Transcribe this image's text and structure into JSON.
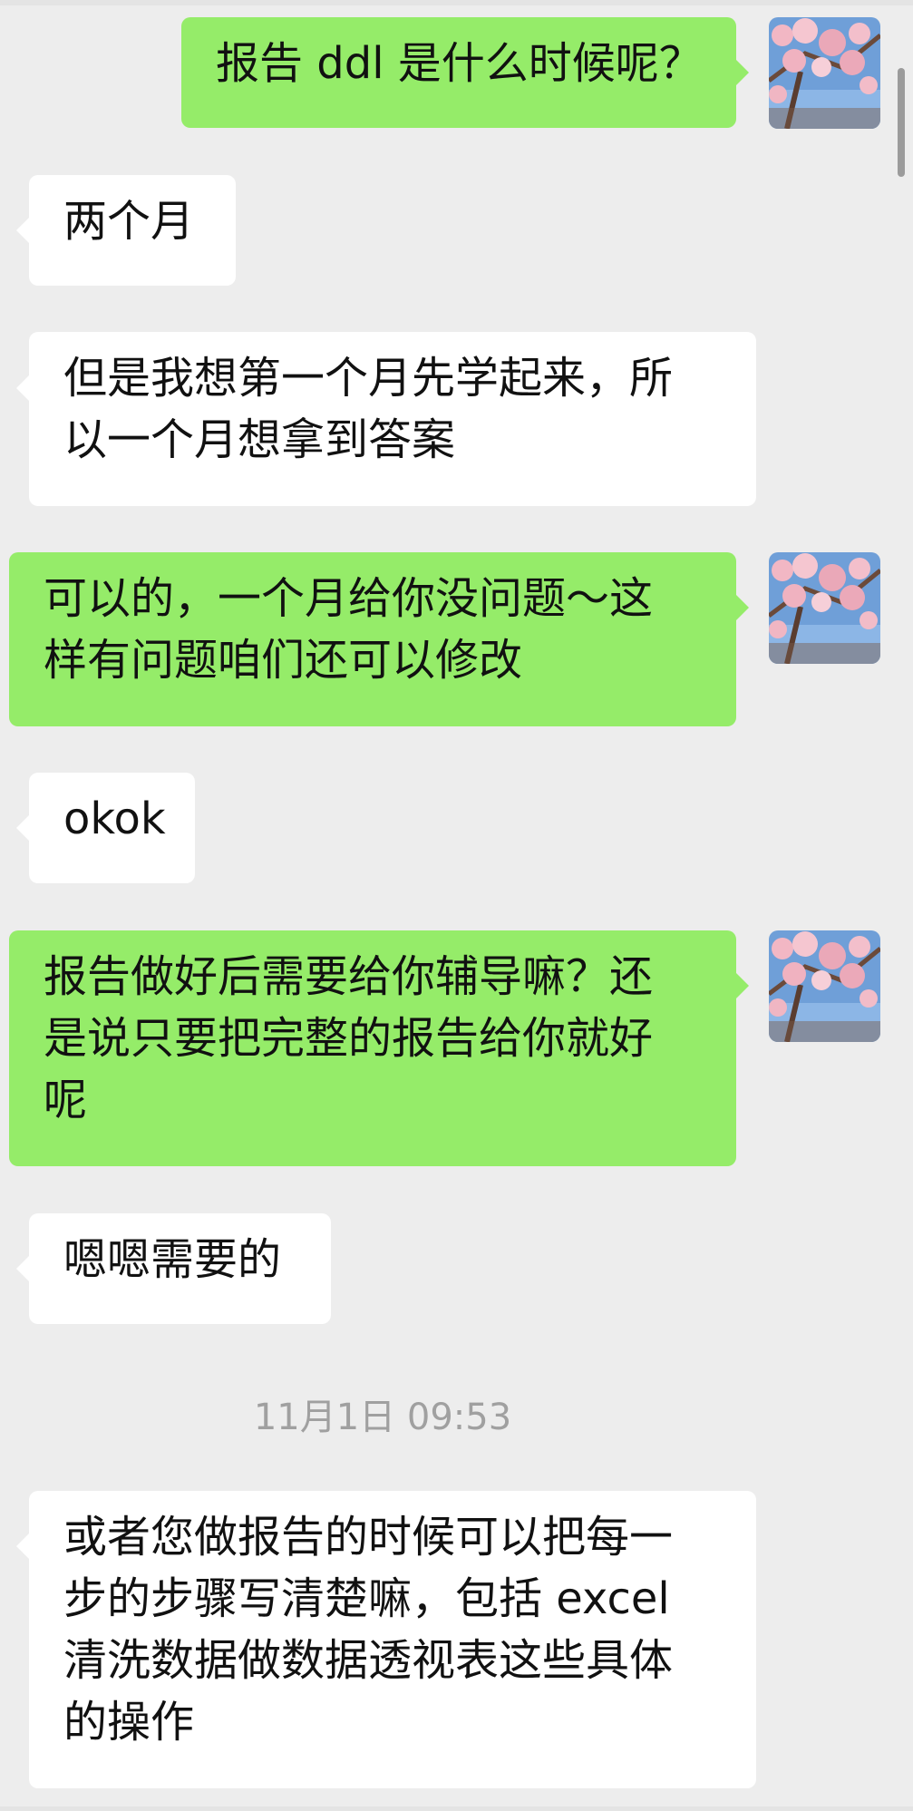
{
  "colors": {
    "background": "#ededed",
    "self_bubble": "#95ec69",
    "peer_bubble": "#ffffff",
    "timestamp_text": "#a0a0a0"
  },
  "avatar": {
    "icon": "cherry-blossom-avatar"
  },
  "messages": [
    {
      "sender": "self",
      "lines": [
        "报告 ddl 是什么时候呢？"
      ]
    },
    {
      "sender": "peer",
      "lines": [
        "两个月"
      ]
    },
    {
      "sender": "peer",
      "lines": [
        "但是我想第一个月先学起来，所",
        "以一个月想拿到答案"
      ]
    },
    {
      "sender": "self",
      "lines": [
        "可以的，一个月给你没问题～这",
        "样有问题咱们还可以修改"
      ]
    },
    {
      "sender": "peer",
      "lines": [
        "okok"
      ]
    },
    {
      "sender": "self",
      "lines": [
        "报告做好后需要给你辅导嘛？还",
        "是说只要把完整的报告给你就好",
        "呢"
      ]
    },
    {
      "sender": "peer",
      "lines": [
        "嗯嗯需要的"
      ]
    },
    {
      "sender": "peer",
      "lines": [
        "或者您做报告的时候可以把每一",
        "步的步骤写清楚嘛，包括 excel",
        "清洗数据做数据透视表这些具体",
        "的操作"
      ]
    }
  ],
  "timestamp": "11月1日 09:53"
}
